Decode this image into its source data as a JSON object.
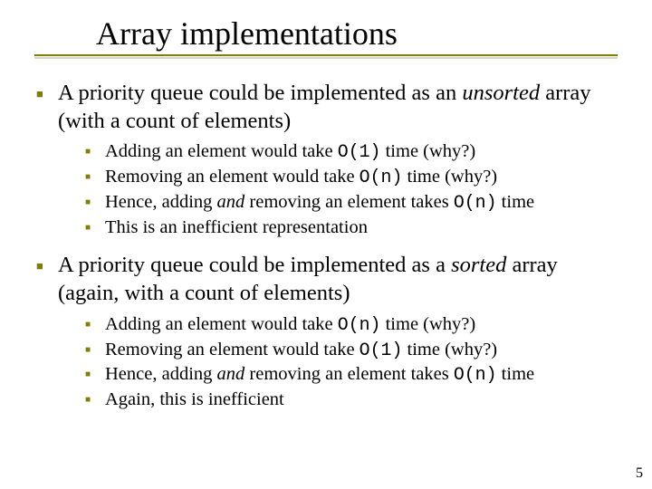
{
  "title": "Array implementations",
  "page_number": "5",
  "blocks": [
    {
      "main": {
        "pre": "A priority queue could be implemented as an ",
        "em": "unsorted",
        "post": " array (with a count of elements)"
      },
      "subs": [
        {
          "t1": "Adding an element would take ",
          "code": "O(1)",
          "t2": " time (why?)"
        },
        {
          "t1": "Removing an element would take ",
          "code": "O(n)",
          "t2": " time (why?)"
        },
        {
          "t1": "Hence, adding ",
          "em": "and",
          "t2": " removing an element takes ",
          "code": "O(n)",
          "t3": " time"
        },
        {
          "t1": "This is an inefficient representation"
        }
      ]
    },
    {
      "main": {
        "pre": "A priority queue could be implemented as a ",
        "em": "sorted",
        "post": " array (again, with a count of elements)"
      },
      "subs": [
        {
          "t1": "Adding an element would take ",
          "code": "O(n)",
          "t2": " time (why?)"
        },
        {
          "t1": "Removing an element would take ",
          "code": "O(1)",
          "t2": " time (why?)"
        },
        {
          "t1": "Hence, adding ",
          "em": "and",
          "t2": " removing an element takes ",
          "code": "O(n)",
          "t3": " time"
        },
        {
          "t1": "Again, this is inefficient"
        }
      ]
    }
  ]
}
